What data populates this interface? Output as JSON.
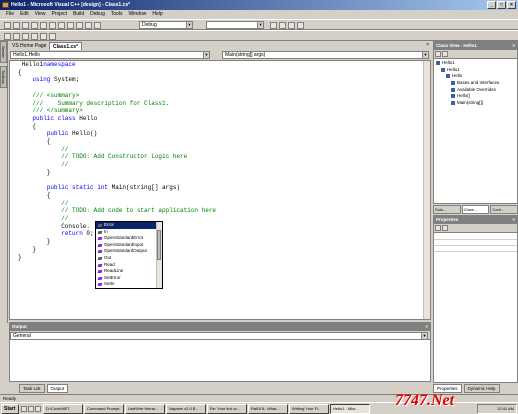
{
  "window": {
    "title": "Hello1 - Microsoft Visual C++ [design] - Class1.cs*"
  },
  "menu": [
    "File",
    "Edit",
    "View",
    "Project",
    "Build",
    "Debug",
    "Tools",
    "Window",
    "Help"
  ],
  "toolbar": {
    "config": "Debug",
    "find": ""
  },
  "left_tabs": [
    "Server Explorer",
    "Toolbox"
  ],
  "doc_tabs": [
    "VS Home Page",
    "Class1.cs*"
  ],
  "nav": {
    "class": "Hello1.Hello",
    "member": "Main(string[] args)"
  },
  "code_lines": [
    {
      "k": "namespace",
      "t": " Hello1"
    },
    {
      "t": "{"
    },
    {
      "t": "    ",
      "k": "using",
      "t2": " System;"
    },
    {
      "t": ""
    },
    {
      "c": "    /// <summary>"
    },
    {
      "c": "    ///    Summary description for Class1."
    },
    {
      "c": "    /// </summary>"
    },
    {
      "t": "    ",
      "k": "public class",
      "t2": " Hello"
    },
    {
      "t": "    {"
    },
    {
      "t": "        ",
      "k": "public",
      "t2": " Hello()"
    },
    {
      "t": "        {"
    },
    {
      "c": "            //"
    },
    {
      "c": "            // TODO: Add Constructor Logic here"
    },
    {
      "c": "            //"
    },
    {
      "t": "        }"
    },
    {
      "t": ""
    },
    {
      "t": "        ",
      "k": "public static int",
      "t2": " Main(string[] args)"
    },
    {
      "t": "        {"
    },
    {
      "c": "            //"
    },
    {
      "c": "            // TODO: Add code to start application here"
    },
    {
      "c": "            //"
    },
    {
      "t": "            Console."
    },
    {
      "t": "            ",
      "k": "return",
      "t2": " 0;"
    },
    {
      "t": "        }"
    },
    {
      "t": "    }"
    },
    {
      "t": "}"
    }
  ],
  "intellisense": {
    "items": [
      "Error",
      "In",
      "OpenStandardError",
      "OpenStandardInput",
      "OpenStandardOutput",
      "Out",
      "Read",
      "ReadLine",
      "SetError",
      "SetIn"
    ],
    "selected": 0
  },
  "class_view": {
    "title": "Class View - Hello1",
    "nodes": [
      {
        "label": "Hello1",
        "depth": 0
      },
      {
        "label": "Hello1",
        "depth": 1
      },
      {
        "label": "Hello",
        "depth": 2
      },
      {
        "label": "Bases and Interfaces",
        "depth": 3
      },
      {
        "label": "Available Overrides",
        "depth": 3
      },
      {
        "label": "Hello()",
        "depth": 3
      },
      {
        "label": "Main(string[])",
        "depth": 3
      }
    ],
    "tabs": [
      "Solu...",
      "Class...",
      "Cont..."
    ]
  },
  "properties": {
    "title": "Properties"
  },
  "output": {
    "title": "Output",
    "pane": "General"
  },
  "bottom_tabs": [
    "Task List",
    "Output"
  ],
  "right_bottom_tabs": [
    "Properties",
    "Dynamic Help"
  ],
  "status": "Ready",
  "taskbar": {
    "start": "Start",
    "buttons": [
      "D:\\Code\\NET",
      "Command Prompt",
      "UseWire Hierar...",
      "Napster v2.0 B...",
      "Re: Your link w...",
      "Ralf101: What...",
      "Writing Your Fi...",
      "Hello1 - Micr..."
    ],
    "active": 7,
    "clock": "12:41 AM"
  },
  "watermark": "7747.Net"
}
